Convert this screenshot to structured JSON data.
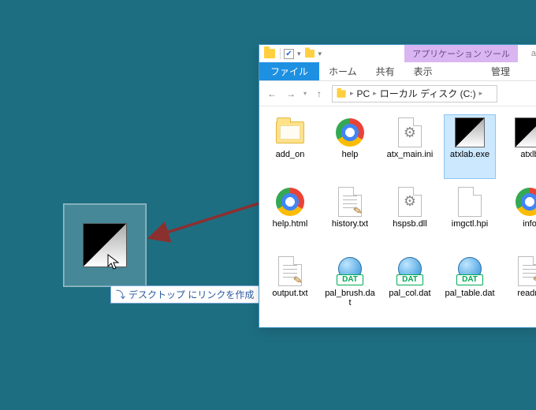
{
  "desktop": {
    "tooltip_glyph": "⤵",
    "tooltip_text": "デスクトップ にリンクを作成"
  },
  "explorer": {
    "context_tools": "アプリケーション ツール",
    "title_trail": "at",
    "tabs": {
      "file": "ファイル",
      "home": "ホーム",
      "share": "共有",
      "view": "表示",
      "manage": "管理"
    },
    "address": {
      "seg1": "PC",
      "seg2": "ローカル ディスク (C:)"
    },
    "files": [
      {
        "name": "add_on",
        "icon": "folder",
        "selected": false
      },
      {
        "name": "help",
        "icon": "chrome",
        "selected": false
      },
      {
        "name": "atx_main.ini",
        "icon": "gears",
        "selected": false
      },
      {
        "name": "atxlab.exe",
        "icon": "app",
        "selected": true
      },
      {
        "name": "atxlb",
        "icon": "app",
        "selected": false
      },
      {
        "name": "help.html",
        "icon": "chrome",
        "selected": false
      },
      {
        "name": "history.txt",
        "icon": "text",
        "selected": false
      },
      {
        "name": "hspsb.dll",
        "icon": "gears",
        "selected": false
      },
      {
        "name": "imgctl.hpi",
        "icon": "page",
        "selected": false
      },
      {
        "name": "info",
        "icon": "chrome",
        "selected": false
      },
      {
        "name": "output.txt",
        "icon": "text",
        "selected": false
      },
      {
        "name": "pal_brush.dat",
        "icon": "dat",
        "selected": false
      },
      {
        "name": "pal_col.dat",
        "icon": "dat",
        "selected": false
      },
      {
        "name": "pal_table.dat",
        "icon": "dat",
        "selected": false
      },
      {
        "name": "readm",
        "icon": "text",
        "selected": false
      }
    ],
    "dat_label": "DAT"
  }
}
